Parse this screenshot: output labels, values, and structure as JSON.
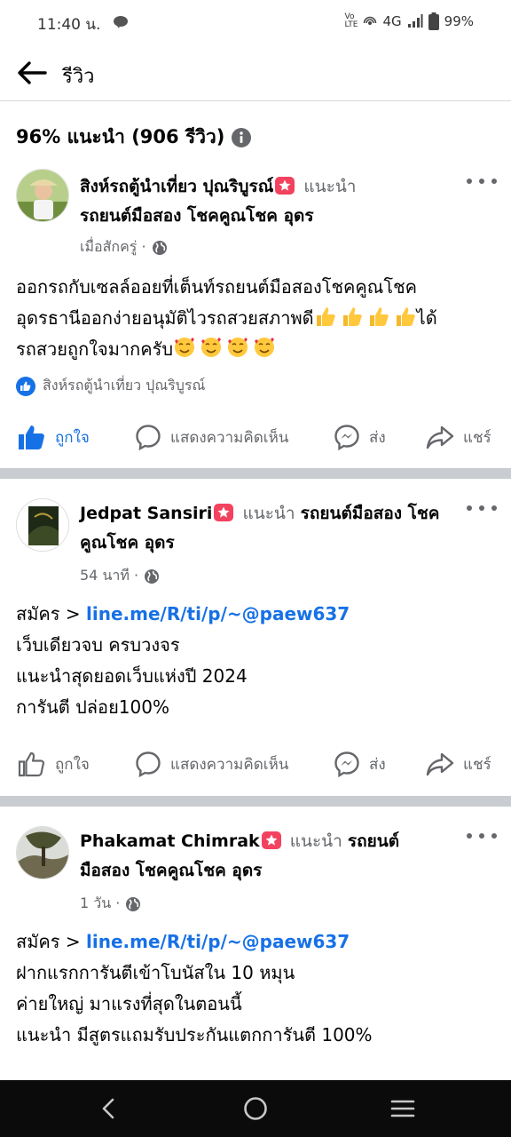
{
  "status_bar": {
    "time": "11:40 น.",
    "network": "4G",
    "battery": "99%"
  },
  "header": {
    "back_icon": "arrow-left-icon",
    "title": "รีวิว"
  },
  "summary": {
    "text": "96% แนะนำ (906 รีวิว)",
    "info_icon": "info-circle-icon"
  },
  "posts": [
    {
      "author": "สิงห์รถตู้นำเที่ยว ปุณริบูรณ์",
      "recommends": "แนะนำ",
      "page_name": "รถยนต์มือสอง โชคคูณโชค อุดร",
      "meta": "เมื่อสักครู่ ·",
      "body_lines": [
        "ออกรถกับเซลล์ออยที่เต็นท์รถยนต์มือสองโชคคูณโชค",
        "อุดรธานีออกง่ายอนุมัติไวรถสวยสภาพดี",
        "ได้",
        "รถสวยถูกใจมากครับ"
      ],
      "liker": "สิงห์รถตู้นำเที่ยว ปุณริบูรณ์",
      "actions": {
        "like": "ถูกใจ",
        "comment": "แสดงความคิดเห็น",
        "send": "ส่ง",
        "share": "แชร์"
      }
    },
    {
      "author": "Jedpat Sansiri",
      "recommends": "แนะนำ",
      "page_name": "รถยนต์มือสอง โชคคูณโชค อุดร",
      "meta": "54 นาที ·",
      "body_prefix": "สมัคร >",
      "body_link": "line.me/R/ti/p/~@paew637",
      "body_lines": [
        "เว็บเดียวจบ ครบวงจร",
        "แนะนำสุดยอดเว็บแห่งปี 2024",
        "การันตี ปล่อย100%"
      ],
      "actions": {
        "like": "ถูกใจ",
        "comment": "แสดงความคิดเห็น",
        "send": "ส่ง",
        "share": "แชร์"
      }
    },
    {
      "author": "Phakamat Chimrak",
      "recommends": "แนะนำ",
      "page_name_a": "รถยนต์",
      "page_name_b": "มือสอง โชคคูณโชค อุดร",
      "meta": "1 วัน ·",
      "body_prefix": "สมัคร >",
      "body_link": "line.me/R/ti/p/~@paew637",
      "body_lines": [
        "ฝากแรกการันตีเข้าโบนัสใน 10 หมุน",
        "ค่ายใหญ่ มาแรงที่สุดในตอนนี้",
        "แนะนำ มีสูตรแถมรับประกันแตกการันตี 100%"
      ]
    }
  ],
  "colors": {
    "accent": "#1771e6",
    "secondary_text": "#65676b",
    "badge": "#f3425f",
    "separator": "#c9ccd1"
  },
  "nav_bar": {
    "back": "back-chevron-icon",
    "home": "home-circle-icon",
    "recents": "recents-lines-icon"
  }
}
